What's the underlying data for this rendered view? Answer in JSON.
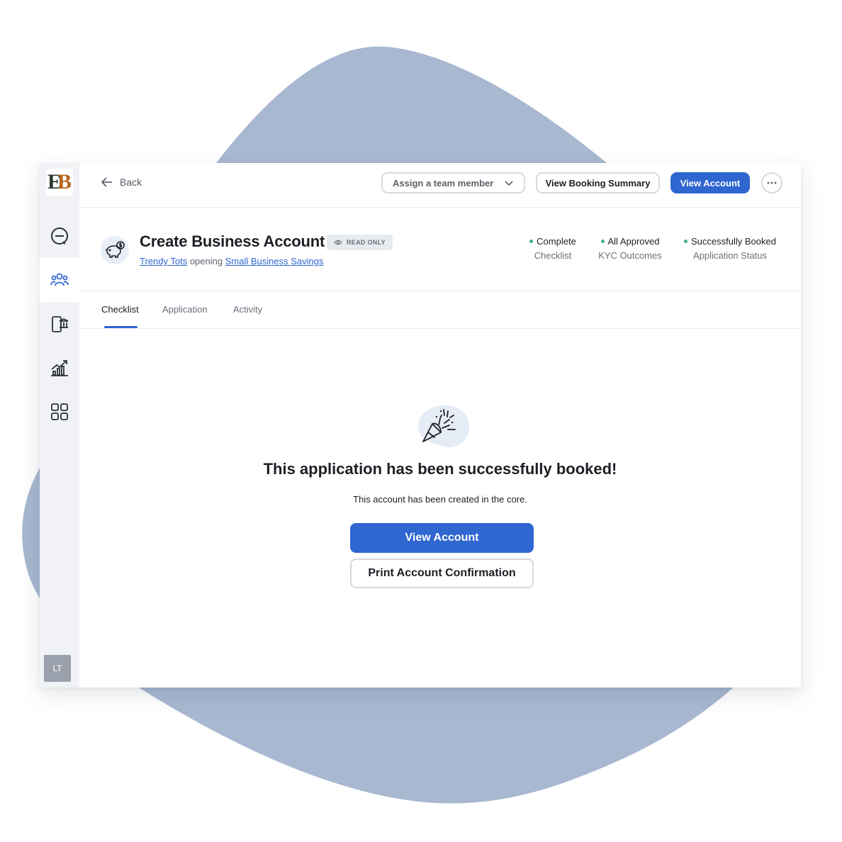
{
  "colors": {
    "accent": "#2f66d0",
    "blob": "#a7b8d0",
    "status_dot": "#3fae7c",
    "sidebar_bg": "#f0f2f5"
  },
  "sidebar": {
    "logo_left": "E",
    "logo_right": "B",
    "items": [
      {
        "icon": "minus-circle-icon"
      },
      {
        "icon": "team-icon",
        "active": true
      },
      {
        "icon": "mobile-bank-icon"
      },
      {
        "icon": "growth-chart-icon"
      },
      {
        "icon": "grid-icon"
      }
    ],
    "avatar_initials": "LT"
  },
  "topbar": {
    "back_label": "Back",
    "assign_label": "Assign a team member",
    "booking_summary_label": "View Booking Summary",
    "view_account_label": "View Account"
  },
  "header": {
    "title": "Create Business Account",
    "badge": "READ ONLY",
    "company": "Trendy Tots",
    "connector": "opening",
    "product": "Small Business Savings",
    "statuses": [
      {
        "value": "Complete",
        "label": "Checklist"
      },
      {
        "value": "All Approved",
        "label": "KYC Outcomes"
      },
      {
        "value": "Successfully Booked",
        "label": "Application Status"
      }
    ]
  },
  "tabs": [
    {
      "label": "Checklist",
      "active": true
    },
    {
      "label": "Application"
    },
    {
      "label": "Activity"
    }
  ],
  "content": {
    "heading": "This application has been successfully booked!",
    "description": "This account has been created in the core.",
    "primary_button": "View Account",
    "secondary_button": "Print Account Confirmation"
  }
}
